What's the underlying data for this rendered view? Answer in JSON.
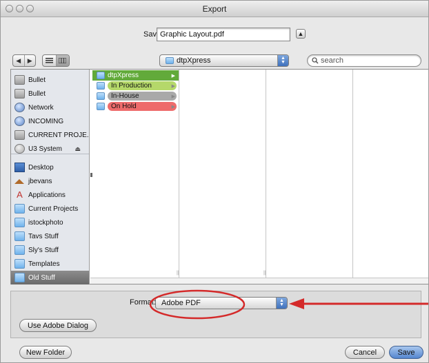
{
  "window": {
    "title": "Export"
  },
  "save_as": {
    "label": "Save As:",
    "filename": "Graphic Layout.pdf"
  },
  "toolbar": {
    "back_icon": "◀",
    "forward_icon": "▶",
    "location": "dtpXpress",
    "search_placeholder": "search"
  },
  "sidebar": {
    "devices": [
      {
        "label": "Bullet",
        "icon": "drive-icon"
      },
      {
        "label": "Bullet",
        "icon": "drive-icon"
      },
      {
        "label": "Network",
        "icon": "network-icon"
      },
      {
        "label": "INCOMING",
        "icon": "network-volume-icon"
      },
      {
        "label": "CURRENT PROJE...",
        "icon": "drive-icon"
      },
      {
        "label": "U3 System",
        "icon": "usb-drive-icon"
      }
    ],
    "places": [
      {
        "label": "Desktop",
        "icon": "desktop-icon"
      },
      {
        "label": "jbevans",
        "icon": "home-icon"
      },
      {
        "label": "Applications",
        "icon": "applications-icon"
      },
      {
        "label": "Current Projects",
        "icon": "folder-icon"
      },
      {
        "label": "istockphoto",
        "icon": "folder-icon"
      },
      {
        "label": "Tavs Stuff",
        "icon": "folder-icon"
      },
      {
        "label": "Sly's Stuff",
        "icon": "folder-icon"
      },
      {
        "label": "Templates",
        "icon": "folder-icon"
      },
      {
        "label": "Old Stuff",
        "icon": "folder-icon",
        "selected": true
      }
    ]
  },
  "columns": {
    "first": [
      {
        "label": "dtpXpress",
        "selected": true
      },
      {
        "label": "In Production",
        "color": "#b5d86a"
      },
      {
        "label": "In-House",
        "color": "#a9a9a9"
      },
      {
        "label": "On Hold",
        "color": "#ee6b6b"
      }
    ]
  },
  "format": {
    "label": "Format:",
    "value": "Adobe PDF"
  },
  "buttons": {
    "use_adobe_dialog": "Use Adobe Dialog",
    "new_folder": "New Folder",
    "cancel": "Cancel",
    "save": "Save"
  },
  "colors": {
    "annotation": "#d42a2a",
    "selection_green": "#62aa3a",
    "accent_blue": "#5586cf"
  }
}
